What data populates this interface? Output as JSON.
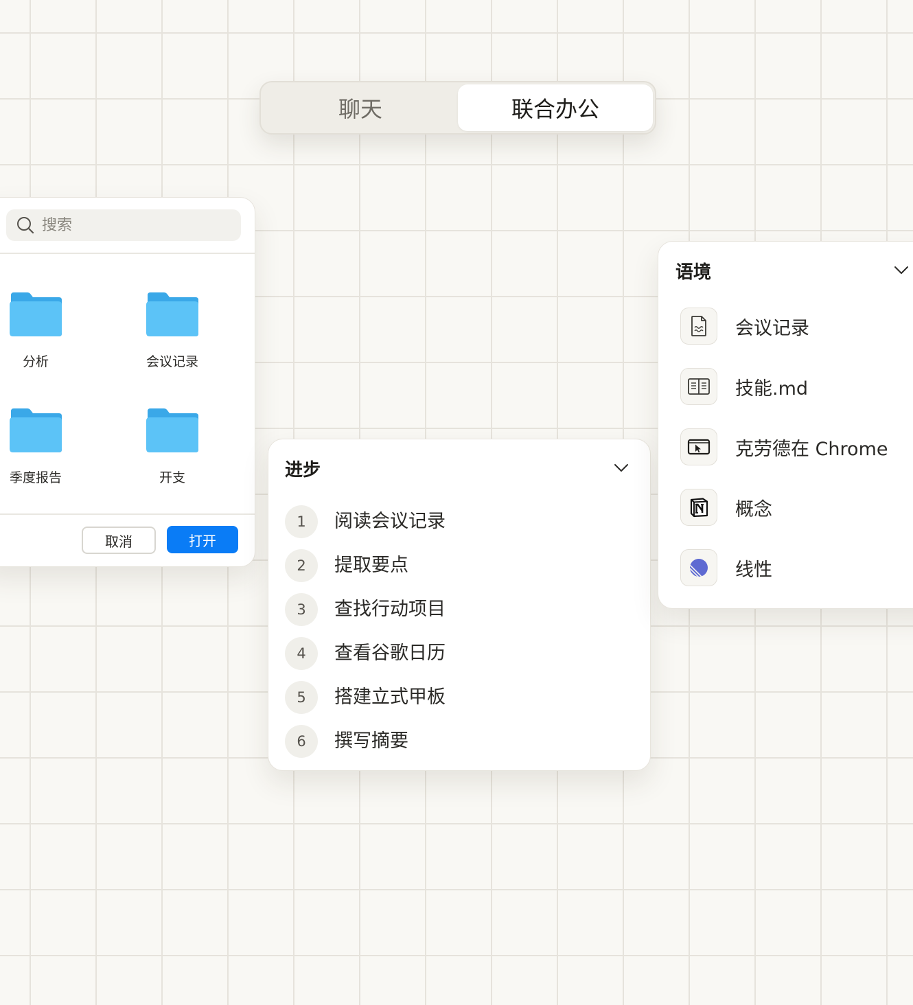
{
  "mode_toggle": {
    "tabs": [
      {
        "label": "聊天",
        "active": false
      },
      {
        "label": "联合办公",
        "active": true
      }
    ]
  },
  "file_dialog": {
    "search_placeholder": "搜索",
    "folders": [
      {
        "label": "分析"
      },
      {
        "label": "会议记录"
      },
      {
        "label": "季度报告"
      },
      {
        "label": "开支"
      }
    ],
    "cancel_label": "取消",
    "open_label": "打开"
  },
  "progress": {
    "title": "进步",
    "steps": [
      {
        "number": "1",
        "label": "阅读会议记录"
      },
      {
        "number": "2",
        "label": "提取要点"
      },
      {
        "number": "3",
        "label": "查找行动项目"
      },
      {
        "number": "4",
        "label": "查看谷歌日历"
      },
      {
        "number": "5",
        "label": "搭建立式甲板"
      },
      {
        "number": "6",
        "label": "撰写摘要"
      }
    ]
  },
  "context": {
    "title": "语境",
    "items": [
      {
        "label": "会议记录",
        "icon": "document-icon"
      },
      {
        "label": "技能.md",
        "icon": "book-icon"
      },
      {
        "label": "克劳德在 Chrome",
        "icon": "browser-cursor-icon"
      },
      {
        "label": "概念",
        "icon": "notion-icon"
      },
      {
        "label": "线性",
        "icon": "linear-icon"
      }
    ]
  },
  "colors": {
    "background": "#f9f8f4",
    "grid_line": "#e6e3dc",
    "primary_button": "#0a7cf6",
    "folder": "#5cc3f7",
    "linear_accent": "#5e6ad2"
  }
}
